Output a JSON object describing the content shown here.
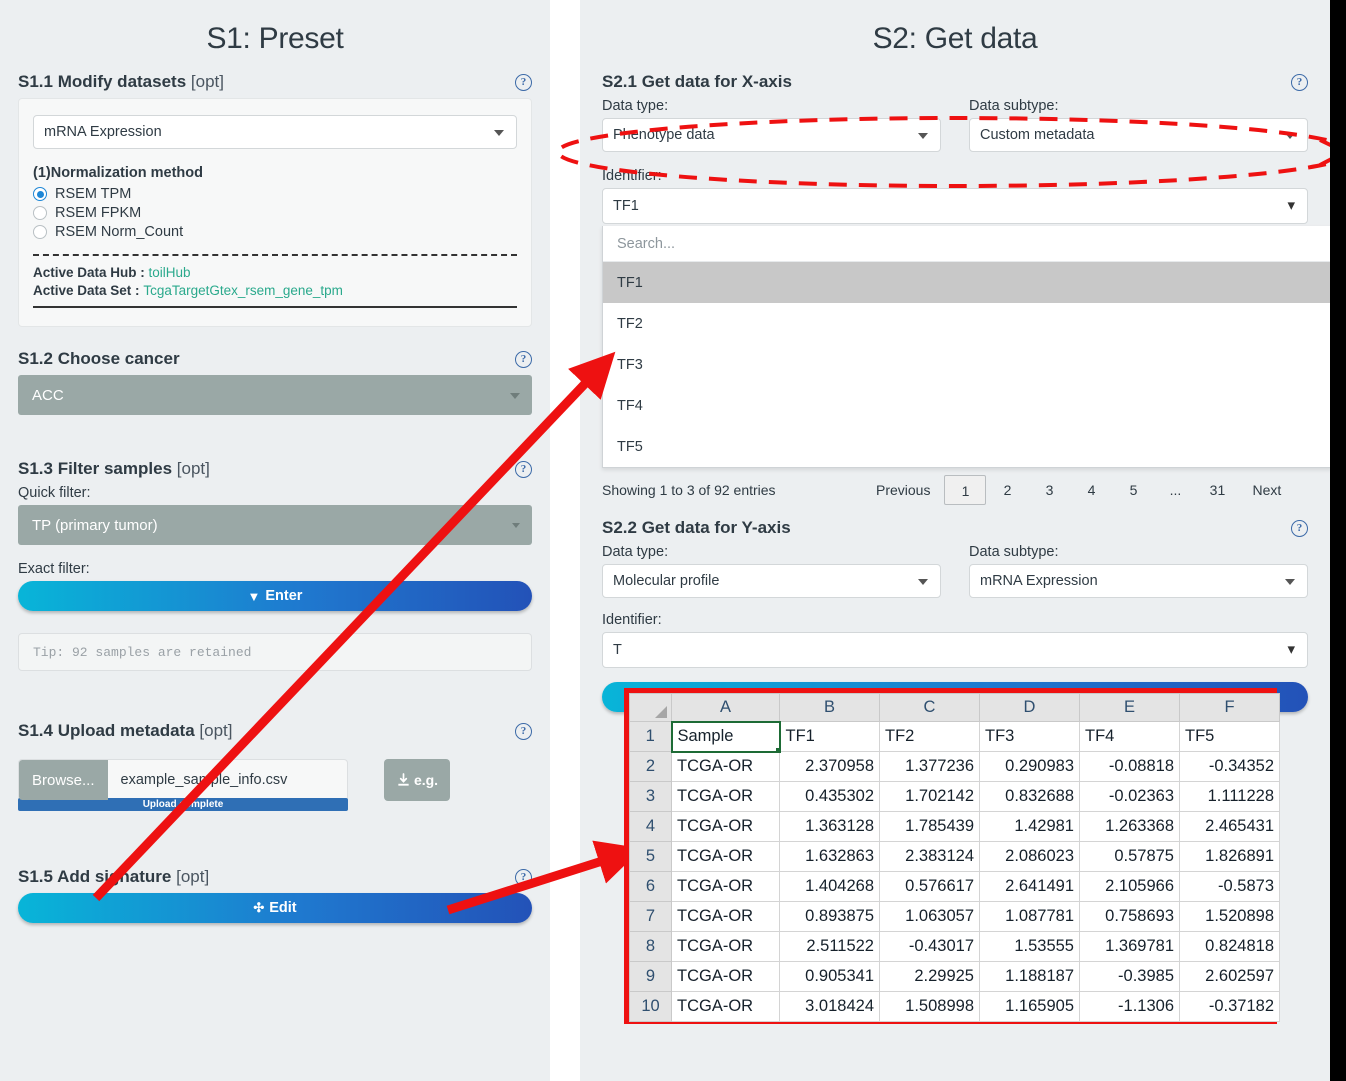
{
  "panel_s1": {
    "title": "S1: Preset",
    "s1_1": {
      "heading": "S1.1 Modify datasets",
      "optional": "[opt]",
      "dataset_select": "mRNA Expression",
      "norm_title": "(1)Normalization method",
      "radios": [
        {
          "label": "RSEM TPM",
          "selected": true
        },
        {
          "label": "RSEM FPKM",
          "selected": false
        },
        {
          "label": "RSEM Norm_Count",
          "selected": false
        }
      ],
      "active_hub_label": "Active Data Hub :",
      "active_hub_value": "toilHub",
      "active_set_label": "Active Data Set :",
      "active_set_value": "TcgaTargetGtex_rsem_gene_tpm"
    },
    "s1_2": {
      "heading": "S1.2 Choose cancer",
      "cancer_select": "ACC"
    },
    "s1_3": {
      "heading": "S1.3 Filter samples",
      "optional": "[opt]",
      "quick_filter_label": "Quick filter:",
      "quick_filter_value": "TP (primary tumor)",
      "exact_filter_label": "Exact filter:",
      "enter_button": "Enter",
      "tip": "Tip: 92 samples are retained"
    },
    "s1_4": {
      "heading": "S1.4 Upload metadata",
      "optional": "[opt]",
      "browse_button": "Browse...",
      "file_name": "example_sample_info.csv",
      "progress_label": "Upload complete",
      "example_button": "e.g."
    },
    "s1_5": {
      "heading": "S1.5 Add signature",
      "optional": "[opt]",
      "edit_button": "Edit"
    }
  },
  "panel_s2": {
    "title": "S2: Get data",
    "s2_1": {
      "heading": "S2.1 Get data for X-axis",
      "data_type_label": "Data type:",
      "data_type_value": "Phenotype data",
      "data_subtype_label": "Data subtype:",
      "data_subtype_value": "Custom metadata",
      "identifier_label": "Identifier:",
      "identifier_value": "TF1",
      "dropdown": {
        "search_placeholder": "Search...",
        "options": [
          "TF1",
          "TF2",
          "TF3",
          "TF4",
          "TF5"
        ],
        "selected": "TF1"
      },
      "pagination": {
        "showing": "Showing 1 to 3 of 92 entries",
        "previous": "Previous",
        "pages": [
          "1",
          "2",
          "3",
          "4",
          "5",
          "...",
          "31"
        ],
        "active_page": "1",
        "next": "Next"
      }
    },
    "s2_2": {
      "heading": "S2.2 Get data for Y-axis",
      "data_type_label": "Data type:",
      "data_type_value": "Molecular profile",
      "data_subtype_label": "Data subtype:",
      "data_subtype_value": "mRNA Expression",
      "identifier_label": "Identifier:",
      "identifier_value": "T"
    }
  },
  "spreadsheet": {
    "columns": [
      "A",
      "B",
      "C",
      "D",
      "E",
      "F"
    ],
    "rows": [
      {
        "n": "1",
        "cells": [
          "Sample",
          "TF1",
          "TF2",
          "TF3",
          "TF4",
          "TF5"
        ],
        "header": true
      },
      {
        "n": "2",
        "cells": [
          "TCGA-OR",
          "2.370958",
          "1.377236",
          "0.290983",
          "-0.08818",
          "-0.34352"
        ]
      },
      {
        "n": "3",
        "cells": [
          "TCGA-OR",
          "0.435302",
          "1.702142",
          "0.832688",
          "-0.02363",
          "1.111228"
        ]
      },
      {
        "n": "4",
        "cells": [
          "TCGA-OR",
          "1.363128",
          "1.785439",
          "1.42981",
          "1.263368",
          "2.465431"
        ]
      },
      {
        "n": "5",
        "cells": [
          "TCGA-OR",
          "1.632863",
          "2.383124",
          "2.086023",
          "0.57875",
          "1.826891"
        ]
      },
      {
        "n": "6",
        "cells": [
          "TCGA-OR",
          "1.404268",
          "0.576617",
          "2.641491",
          "2.105966",
          "-0.5873"
        ]
      },
      {
        "n": "7",
        "cells": [
          "TCGA-OR",
          "0.893875",
          "1.063057",
          "1.087781",
          "0.758693",
          "1.520898"
        ]
      },
      {
        "n": "8",
        "cells": [
          "TCGA-OR",
          "2.511522",
          "-0.43017",
          "1.53555",
          "1.369781",
          "0.824818"
        ]
      },
      {
        "n": "9",
        "cells": [
          "TCGA-OR",
          "0.905341",
          "2.29925",
          "1.188187",
          "-0.3985",
          "2.602597"
        ]
      },
      {
        "n": "10",
        "cells": [
          "TCGA-OR",
          "3.018424",
          "1.508998",
          "1.165905",
          "-1.1306",
          "-0.37182"
        ]
      }
    ]
  },
  "colors": {
    "annotation_red": "#ee1111",
    "panel_bg": "#eceff1",
    "gray_select": "#9aa8a6",
    "accent_blue": "#1f79cf",
    "link_green": "#2aa98c"
  }
}
